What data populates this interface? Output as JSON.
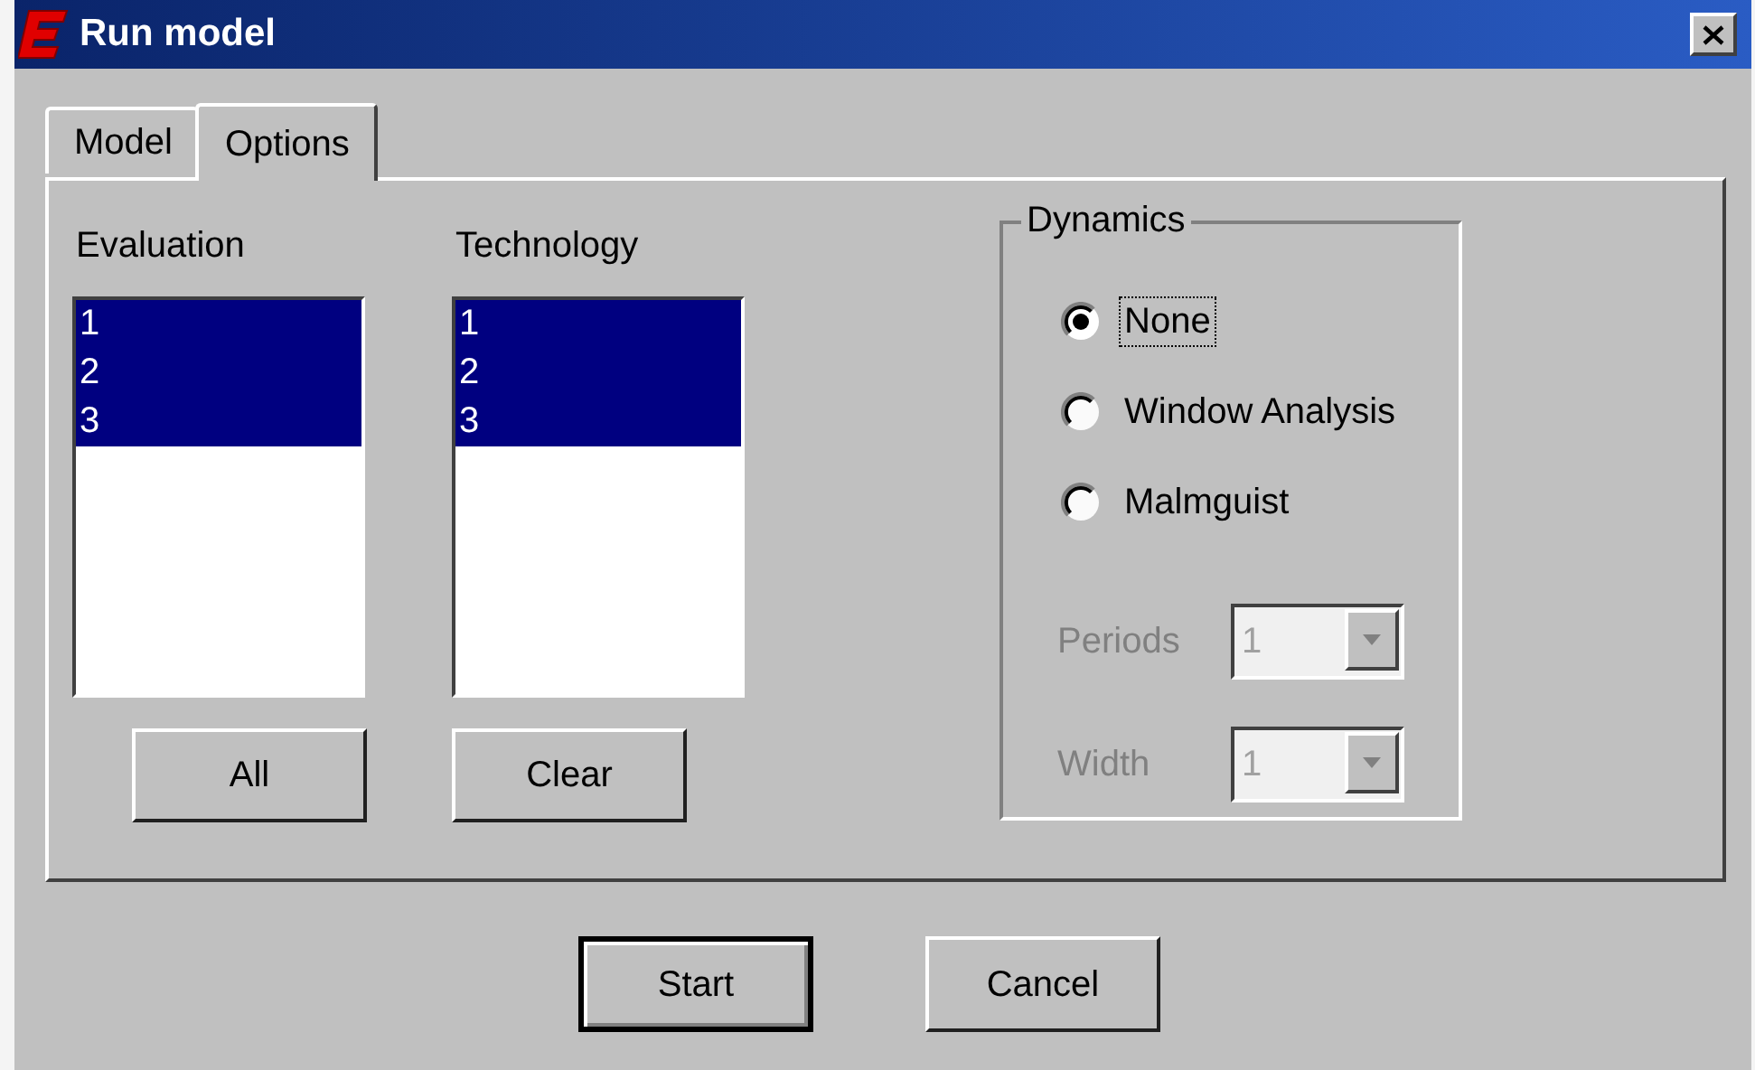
{
  "window": {
    "title": "Run model"
  },
  "tabs": [
    {
      "label": "Model",
      "selected": false
    },
    {
      "label": "Options",
      "selected": true
    }
  ],
  "lists": [
    {
      "label": "Evaluation",
      "items": [
        {
          "text": "1",
          "selected": true
        },
        {
          "text": "2",
          "selected": true
        },
        {
          "text": "3",
          "selected": true
        }
      ]
    },
    {
      "label": "Technology",
      "items": [
        {
          "text": "1",
          "selected": true
        },
        {
          "text": "2",
          "selected": true
        },
        {
          "text": "3",
          "selected": true
        }
      ]
    }
  ],
  "list_buttons": [
    {
      "label": "All"
    },
    {
      "label": "Clear"
    }
  ],
  "dynamics": {
    "title": "Dynamics",
    "options": [
      {
        "label": "None",
        "selected": true,
        "focused": true
      },
      {
        "label": "Window Analysis",
        "selected": false,
        "focused": false
      },
      {
        "label": "Malmguist",
        "selected": false,
        "focused": false
      }
    ],
    "fields": [
      {
        "label": "Periods",
        "value": "1",
        "disabled": true
      },
      {
        "label": "Width",
        "value": "1",
        "disabled": true
      }
    ]
  },
  "buttons": [
    {
      "label": "Start",
      "default": true
    },
    {
      "label": "Cancel",
      "default": false
    }
  ]
}
